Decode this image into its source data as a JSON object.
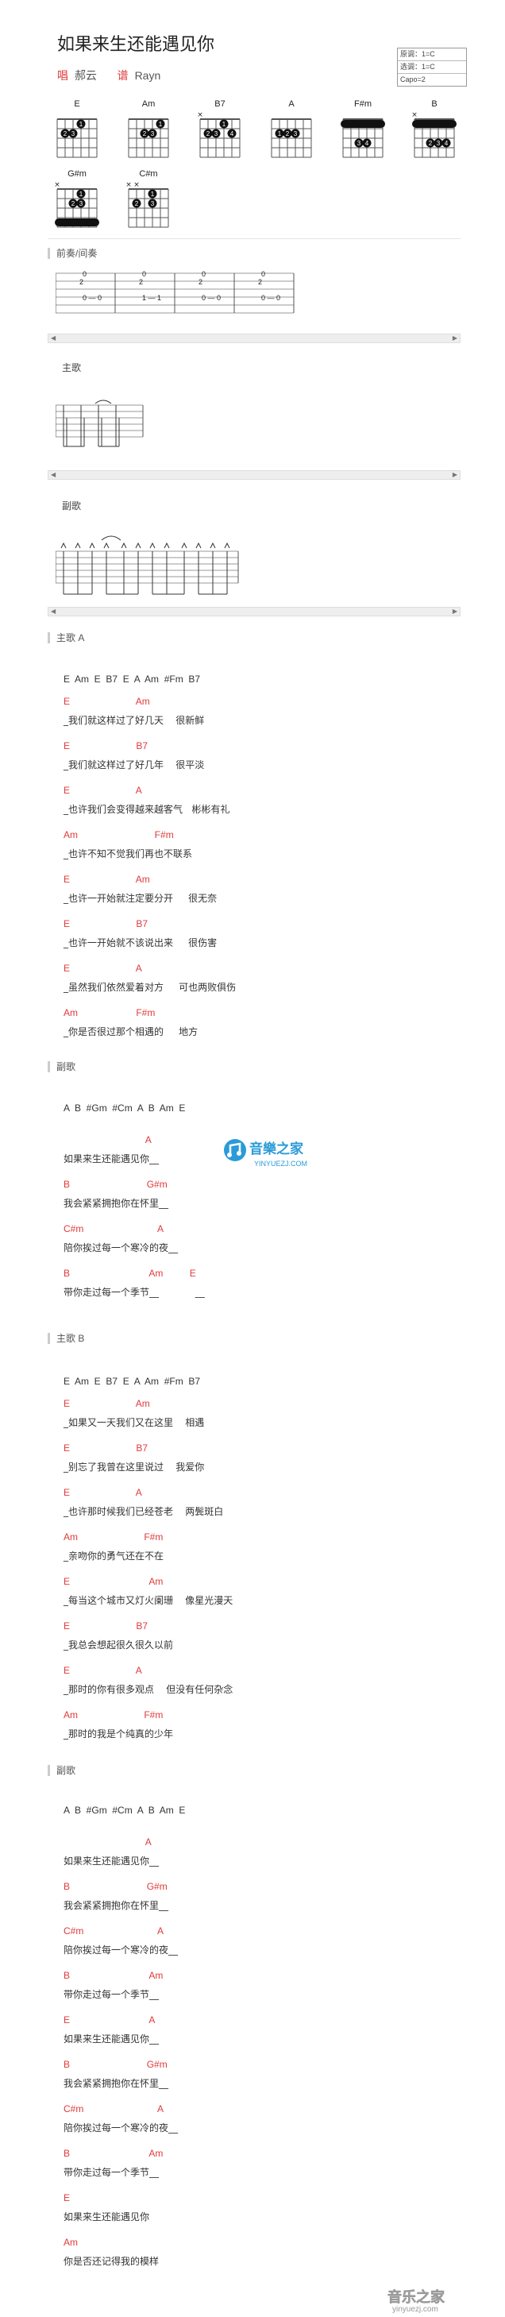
{
  "header": {
    "title": "如果来生还能遇见你",
    "singer_tag": "唱",
    "singer": "郝云",
    "arranger_tag": "谱",
    "arranger": "Rayn"
  },
  "keybox": {
    "original_key": "原调：1=C",
    "play_key": "选调：1=C",
    "capo": "Capo=2"
  },
  "chords": [
    "E",
    "Am",
    "B7",
    "A",
    "F#m",
    "B",
    "G#m",
    "C#m"
  ],
  "sections": {
    "intro": "前奏/间奏",
    "verse": "主歌",
    "chorus": "副歌",
    "verse_a": "主歌 A",
    "chorus_1": "副歌",
    "verse_b": "主歌 B",
    "chorus_2": "副歌"
  },
  "intro_tab": {
    "row1": [
      "0",
      "0",
      "0",
      "0"
    ],
    "row2": [
      "2",
      "2",
      "2",
      "2"
    ],
    "row3": [
      "0 — 0",
      "1 — 1",
      "0 — 0",
      "0 — 0"
    ]
  },
  "verse_a": {
    "progression": "E  Am  E  B7  E  A  Am  #Fm  B7",
    "lines": [
      {
        "chords": "E                         Am",
        "lyric": "_我们就这样过了好几天    很新鲜"
      },
      {
        "chords": "E                         B7",
        "lyric": "_我们就这样过了好几年    很平淡"
      },
      {
        "chords": "E                         A",
        "lyric": "_也许我们会变得越来越客气   彬彬有礼"
      },
      {
        "chords": "Am                             F#m",
        "lyric": "_也许不知不觉我们再也不联系"
      },
      {
        "chords": "E                         Am",
        "lyric": "_也许一开始就注定要分开     很无奈"
      },
      {
        "chords": "E                         B7",
        "lyric": "_也许一开始就不该说出来     很伤害"
      },
      {
        "chords": "E                         A",
        "lyric": "_虽然我们依然爱着对方     可也两败俱伤"
      },
      {
        "chords": "Am                      F#m",
        "lyric": "_你是否很过那个相遇的     地方"
      }
    ]
  },
  "chorus_1": {
    "progression": "A  B  #Gm  #Cm  A  B  Am  E",
    "lines": [
      {
        "chords": "                               A",
        "lyric": "如果来生还能遇见你__"
      },
      {
        "chords": "B                             G#m",
        "lyric": "我会紧紧拥抱你在怀里__"
      },
      {
        "chords": "C#m                            A",
        "lyric": "陪你挨过每一个寒冷的夜__"
      },
      {
        "chords": "B                              Am          E",
        "lyric": "带你走过每一个季节__            __"
      }
    ]
  },
  "verse_b": {
    "progression": "E  Am  E  B7  E  A  Am  #Fm  B7",
    "lines": [
      {
        "chords": "E                         Am",
        "lyric": "_如果又一天我们又在这里    相遇"
      },
      {
        "chords": "E                         B7",
        "lyric": "_别忘了我曾在这里说过    我爱你"
      },
      {
        "chords": "E                         A",
        "lyric": "_也许那时候我们已经苍老    两鬓斑白"
      },
      {
        "chords": "Am                         F#m",
        "lyric": "_亲吻你的勇气还在不在"
      },
      {
        "chords": "E                              Am",
        "lyric": "_每当这个城市又灯火阑珊    像星光漫天"
      },
      {
        "chords": "E                         B7",
        "lyric": "_我总会想起很久很久以前"
      },
      {
        "chords": "E                         A",
        "lyric": "_那时的你有很多观点    但没有任何杂念"
      },
      {
        "chords": "Am                         F#m",
        "lyric": "_那时的我是个纯真的少年"
      }
    ]
  },
  "chorus_2": {
    "progression": "A  B  #Gm  #Cm  A  B  Am  E",
    "lines": [
      {
        "chords": "                               A",
        "lyric": "如果来生还能遇见你__"
      },
      {
        "chords": "B                             G#m",
        "lyric": "我会紧紧拥抱你在怀里__"
      },
      {
        "chords": "C#m                            A",
        "lyric": "陪你挨过每一个寒冷的夜__"
      },
      {
        "chords": "B                              Am",
        "lyric": "带你走过每一个季节__"
      },
      {
        "chords": "E                              A",
        "lyric": "如果来生还能遇见你__"
      },
      {
        "chords": "B                             G#m",
        "lyric": "我会紧紧拥抱你在怀里__"
      },
      {
        "chords": "C#m                            A",
        "lyric": "陪你挨过每一个寒冷的夜__"
      },
      {
        "chords": "B                              Am",
        "lyric": "带你走过每一个季节__"
      },
      {
        "chords": "E",
        "lyric": "如果来生还能遇见你"
      },
      {
        "chords": "Am",
        "lyric": "你是否还记得我的模样"
      }
    ]
  },
  "watermark": {
    "text": "音樂之家",
    "url": "YINYUEZJ.COM"
  },
  "footer_logo": {
    "text": "音乐之家",
    "url": "yinyuezj.com"
  },
  "colors": {
    "chord": "#e03a3a",
    "watermark": "#2a9bd8"
  }
}
